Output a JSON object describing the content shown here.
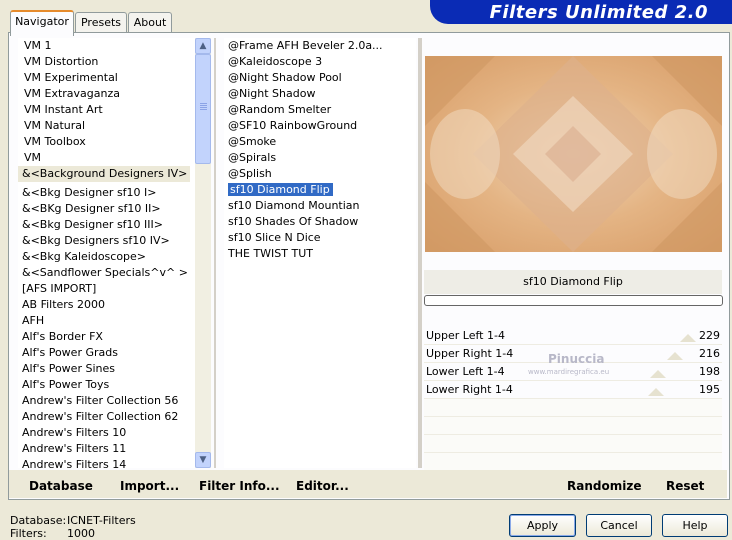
{
  "tabs": [
    {
      "label": "Navigator"
    },
    {
      "label": "Presets"
    },
    {
      "label": "About"
    }
  ],
  "banner": {
    "title": "Filters Unlimited 2.0",
    "color": "#0a2bb5"
  },
  "categories": [
    "VM 1",
    "VM Distortion",
    "VM Experimental",
    "VM Extravaganza",
    "VM Instant Art",
    "VM Natural",
    "VM Toolbox",
    "VM",
    "&<Background Designers IV>",
    "&<Bkg Designer sf10 I>",
    "&<BKg Designer sf10 II>",
    "&<Bkg Designer sf10 III>",
    "&<Bkg Designers sf10 IV>",
    "&<Bkg Kaleidoscope>",
    "&<Sandflower Specials^v^ >",
    "[AFS IMPORT]",
    "AB Filters 2000",
    "AFH",
    "Alf's Border FX",
    "Alf's Power Grads",
    "Alf's Power Sines",
    "Alf's Power Toys",
    "Andrew's Filter Collection 56",
    "Andrew's Filter Collection 62",
    "Andrew's Filters 10",
    "Andrew's Filters 11",
    "Andrew's Filters 14"
  ],
  "selected_category": "&<Background Designers IV>",
  "filters": [
    "@Frame AFH Beveler 2.0a...",
    "@Kaleidoscope 3",
    "@Night Shadow Pool",
    "@Night Shadow",
    "@Random Smelter",
    "@SF10 RainbowGround",
    "@Smoke",
    "@Spirals",
    "@Splish",
    "sf10 Diamond Flip",
    "sf10 Diamond Mountian",
    "sf10 Shades Of Shadow",
    "sf10 Slice N Dice",
    "THE TWIST TUT"
  ],
  "selected_filter": "sf10 Diamond Flip",
  "filter_name": "sf10 Diamond Flip",
  "params": [
    {
      "label": "Upper Left 1-4",
      "value": "229",
      "level": 229
    },
    {
      "label": "Upper Right 1-4",
      "value": "216",
      "level": 216
    },
    {
      "label": "Lower Left 1-4",
      "value": "198",
      "level": 198
    },
    {
      "label": "Lower Right 1-4",
      "value": "195",
      "level": 195
    }
  ],
  "watermark": {
    "line1": "Pinuccia",
    "line2": "www.mardiregrafica.eu"
  },
  "bottom_links": {
    "database": "Database",
    "import": "Import...",
    "filter_info": "Filter Info...",
    "editor": "Editor...",
    "randomize": "Randomize",
    "reset": "Reset"
  },
  "status": {
    "database_label": "Database:",
    "database_value": "ICNET-Filters",
    "filters_label": "Filters:",
    "filters_value": "1000"
  },
  "buttons": {
    "apply": "Apply",
    "cancel": "Cancel",
    "help": "Help"
  }
}
